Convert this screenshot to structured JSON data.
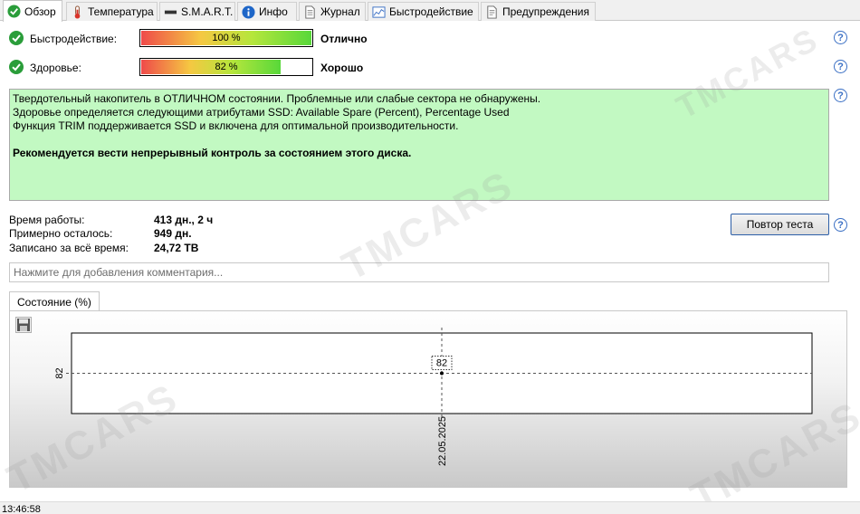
{
  "tabs": [
    {
      "label": "Обзор",
      "icon": "check-circle-icon",
      "active": true
    },
    {
      "label": "Температура",
      "icon": "thermometer-icon",
      "active": false
    },
    {
      "label": "S.M.A.R.T.",
      "icon": "smart-bar-icon",
      "active": false
    },
    {
      "label": "Инфо",
      "icon": "info-icon",
      "active": false
    },
    {
      "label": "Журнал",
      "icon": "document-icon",
      "active": false
    },
    {
      "label": "Быстродействие",
      "icon": "performance-chart-icon",
      "active": false
    },
    {
      "label": "Предупреждения",
      "icon": "warnings-document-icon",
      "active": false
    }
  ],
  "performance": {
    "label": "Быстродействие:",
    "bar_text": "100 %",
    "percent": 100,
    "status": "Отлично"
  },
  "health": {
    "label": "Здоровье:",
    "bar_text": "82 %",
    "percent": 82,
    "status": "Хорошо"
  },
  "info_box": {
    "line1": "Твердотельный накопитель в ОТЛИЧНОМ состоянии. Проблемные или слабые сектора не обнаружены.",
    "line2": "Здоровье определяется следующими атрибутами SSD: Available Spare (Percent), Percentage Used",
    "line3": "Функция TRIM поддерживается SSD и включена для оптимальной производительности.",
    "recommendation": "Рекомендуется вести непрерывный контроль за состоянием этого диска."
  },
  "stats": {
    "uptime_label": "Время работы:",
    "uptime_value": "413 дн., 2 ч",
    "remaining_label": "Примерно осталось:",
    "remaining_value": "949 дн.",
    "written_label": "Записано за всё время:",
    "written_value": "24,72 TB"
  },
  "retest_button": "Повтор теста",
  "help_glyph": "?",
  "comment": {
    "placeholder": "Нажмите для добавления комментария..."
  },
  "chart_tab": "Состояние (%)",
  "chart_data": {
    "type": "line",
    "x": [
      "22.05.2025"
    ],
    "series": [
      {
        "values": [
          82
        ]
      }
    ],
    "ylabel_tick": "82",
    "point_label": "82",
    "xtick": "22.05.2025"
  },
  "statusbar": {
    "time": "13:46:58"
  },
  "watermark": "TMCARS",
  "colors": {
    "info_bg": "#c2f9c2",
    "check_green": "#2a9d3a",
    "help_blue": "#3a6fc4"
  }
}
